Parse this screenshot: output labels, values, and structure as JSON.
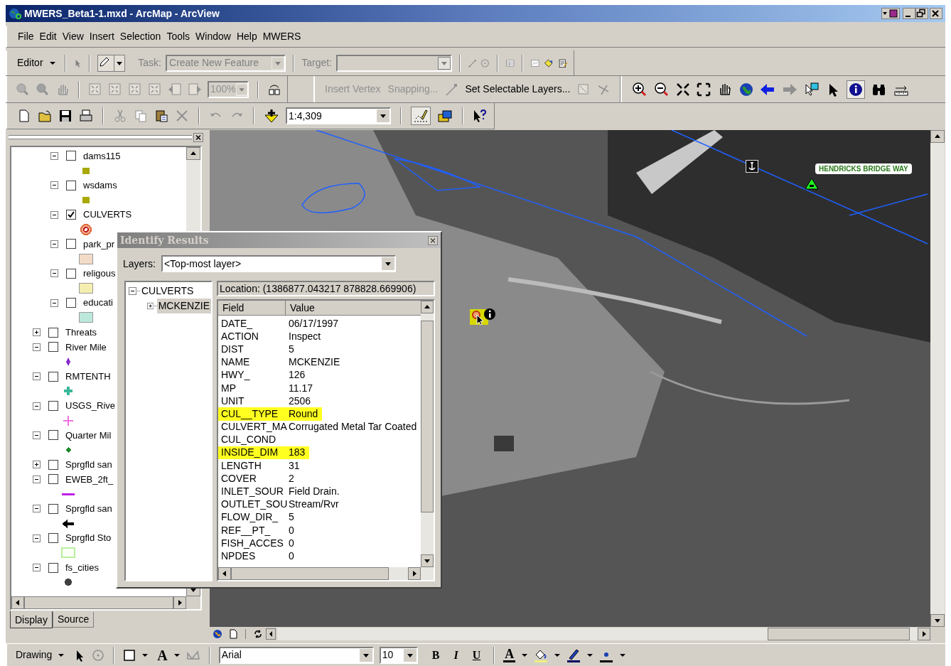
{
  "window": {
    "title": "MWERS_Beta1-1.mxd - ArcMap - ArcView"
  },
  "menu": [
    "File",
    "Edit",
    "View",
    "Insert",
    "Selection",
    "Tools",
    "Window",
    "Help",
    "MWERS"
  ],
  "editor_toolbar": {
    "editor_menu": "Editor",
    "task_label": "Task:",
    "task": "Create New Feature",
    "target_label": "Target:"
  },
  "layout_toolbar": {
    "zoom_percent": "100%"
  },
  "topology_toolbar": {
    "insert_vertex": "Insert Vertex",
    "snapping": "Snapping...",
    "set_selectable_layers": "Set Selectable Layers..."
  },
  "tools_toolbar": {
    "identify_selected": true
  },
  "standard_toolbar": {
    "map_scale": "1:4,309"
  },
  "toc": {
    "group_layers": [
      {
        "name": "dams115",
        "checked": false,
        "expanded": true,
        "kind": "square",
        "color": "#a8a800"
      },
      {
        "name": "wsdams",
        "checked": false,
        "expanded": true,
        "kind": "square",
        "color": "#a8a800"
      },
      {
        "name": "CULVERTS",
        "checked": true,
        "expanded": true,
        "kind": "target",
        "color": "#e06a3a"
      },
      {
        "name": "park_pr",
        "checked": false,
        "expanded": true,
        "kind": "box",
        "color": "#f2dcc8"
      },
      {
        "name": "religous",
        "checked": false,
        "expanded": true,
        "kind": "box",
        "color": "#f4eeb0"
      },
      {
        "name": "educati",
        "checked": false,
        "expanded": true,
        "kind": "box",
        "color": "#bce8dc"
      }
    ],
    "layers": [
      {
        "name": "Threats",
        "checked": false,
        "expanded": false
      },
      {
        "name": "River Mile",
        "checked": false,
        "expanded": true,
        "kind": "diamond",
        "color": "#8a2ad0"
      },
      {
        "name": "RMTENTH",
        "checked": false,
        "expanded": true,
        "kind": "cross",
        "color": "#3ab89a"
      },
      {
        "name": "USGS_Rive",
        "checked": false,
        "expanded": true,
        "kind": "plus",
        "color": "#f070e0"
      },
      {
        "name": "Quarter Mil",
        "checked": false,
        "expanded": true,
        "kind": "dot",
        "color": "#1e8a2a"
      },
      {
        "name": "Sprgfld san",
        "checked": false,
        "expanded": false
      },
      {
        "name": "EWEB_2ft_",
        "checked": false,
        "expanded": true,
        "kind": "line",
        "color": "#c020e8"
      },
      {
        "name": "Sprgfld san",
        "checked": false,
        "expanded": true,
        "kind": "arrow",
        "color": "#000000"
      },
      {
        "name": "Sprgfld Sto",
        "checked": false,
        "expanded": true,
        "kind": "outline_box",
        "color": "#b8f0a0"
      },
      {
        "name": "fs_cities",
        "checked": false,
        "expanded": true,
        "kind": "circle",
        "color": "#404040"
      }
    ],
    "tabs": [
      {
        "label": "Display",
        "selected": true
      },
      {
        "label": "Source",
        "selected": false
      }
    ]
  },
  "map": {
    "road_label": "HENDRICKS BRIDGE WAY"
  },
  "identify_results": {
    "title": "Identify Results",
    "layers_label": "Layers:",
    "layers_value": "<Top-most layer>",
    "tree": [
      {
        "name": "CULVERTS",
        "expanded": true,
        "selected": false,
        "children": [
          {
            "name": "MCKENZIE",
            "expanded": false,
            "selected": true
          }
        ]
      }
    ],
    "location": "Location: (1386877.043217 878828.669906)",
    "columns": [
      "Field",
      "Value"
    ],
    "rows": [
      {
        "field": "DATE_",
        "value": "06/17/1997",
        "highlighted": false
      },
      {
        "field": "ACTION",
        "value": "Inspect",
        "highlighted": false
      },
      {
        "field": "DIST",
        "value": "5",
        "highlighted": false
      },
      {
        "field": "NAME",
        "value": "MCKENZIE",
        "highlighted": false
      },
      {
        "field": "HWY_",
        "value": "126",
        "highlighted": false
      },
      {
        "field": "MP",
        "value": "11.17",
        "highlighted": false
      },
      {
        "field": "UNIT",
        "value": "2506",
        "highlighted": false
      },
      {
        "field": "CUL__TYPE",
        "value": "Round",
        "highlighted": true
      },
      {
        "field": "CULVERT_MA",
        "value": "Corrugated Metal Tar Coated",
        "highlighted": false
      },
      {
        "field": "CUL_COND",
        "highlighted": false
      },
      {
        "field": "INSIDE_DIM",
        "value": "183",
        "highlighted": true
      },
      {
        "field": "LENGTH",
        "value": "31",
        "highlighted": false
      },
      {
        "field": "COVER",
        "value": "2",
        "highlighted": false
      },
      {
        "field": "INLET_SOUR",
        "value": "Field Drain.",
        "highlighted": false
      },
      {
        "field": "OUTLET_SOU",
        "value": "Stream/Rvr",
        "highlighted": false
      },
      {
        "field": "FLOW_DIR_",
        "value": "5",
        "highlighted": false
      },
      {
        "field": "REF__PT_",
        "value": "0",
        "highlighted": false
      },
      {
        "field": "FISH_ACCES",
        "value": "0",
        "highlighted": false
      },
      {
        "field": "NPDES",
        "value": "0",
        "highlighted": false
      }
    ]
  },
  "drawing_toolbar": {
    "drawing_menu": "Drawing",
    "text_tool": "A",
    "font": "Arial",
    "font_size": "10",
    "bold": "B",
    "italic": "I",
    "underline": "U",
    "font_color": "A"
  }
}
